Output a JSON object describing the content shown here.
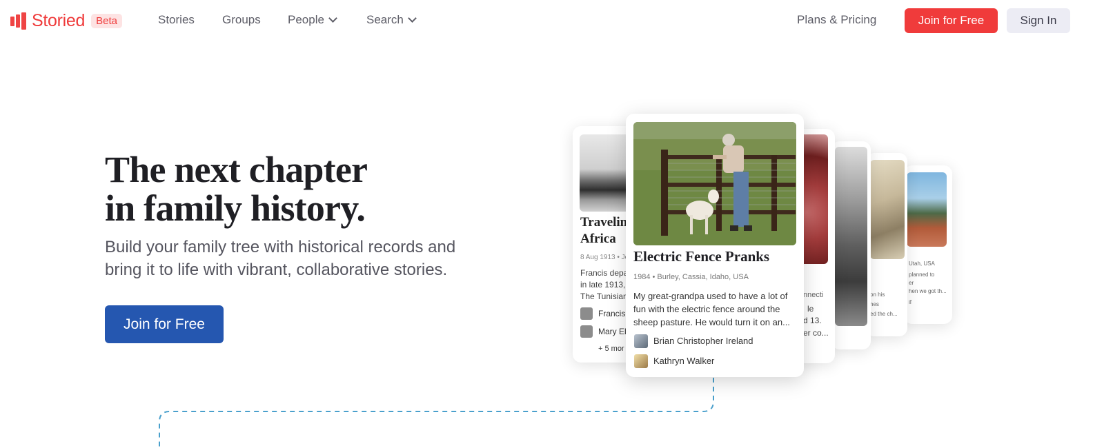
{
  "brand": {
    "name": "Storied",
    "badge": "Beta"
  },
  "nav": {
    "items": [
      "Stories",
      "Groups",
      "People",
      "Search"
    ],
    "plans": "Plans & Pricing",
    "join": "Join for Free",
    "signin": "Sign In"
  },
  "hero": {
    "title_line1": "The next chapter",
    "title_line2": "in family history.",
    "subtitle": "Build your family tree with historical records and bring it to life with vibrant, collaborative stories.",
    "cta": "Join for Free"
  },
  "cards": {
    "featured": {
      "title": "Electric Fence Pranks",
      "meta": "1984 • Burley, Cassia, Idaho, USA",
      "text": "My great-grandpa used to have a lot of fun with the electric fence around the sheep pasture. He would turn it on an...",
      "contributors": [
        "Brian Christopher Ireland",
        "Kathryn Walker"
      ]
    },
    "left": {
      "title_line1": "Travelin",
      "title_line2": "Africa",
      "meta": "8 Aug 1913 • Jo",
      "text_lines": [
        "Francis depa",
        "in late 1913,",
        "The Tunisian"
      ],
      "contributors": [
        "Francis",
        "Mary El"
      ],
      "more": "+ 5 mor"
    },
    "right1": {
      "lines": [
        "nnecti",
        "le",
        "d 13.",
        "er co..."
      ]
    },
    "right2": {
      "lines": [
        "on his",
        "nes",
        "ed the ch..."
      ]
    },
    "right3": {
      "lines": [
        "Utah, USA",
        "planned to",
        "er",
        "hen we got th...",
        "if"
      ]
    }
  },
  "colors": {
    "brand_red": "#ef3b3b",
    "cta_blue": "#2557b0",
    "signin_bg": "#ececf4"
  }
}
